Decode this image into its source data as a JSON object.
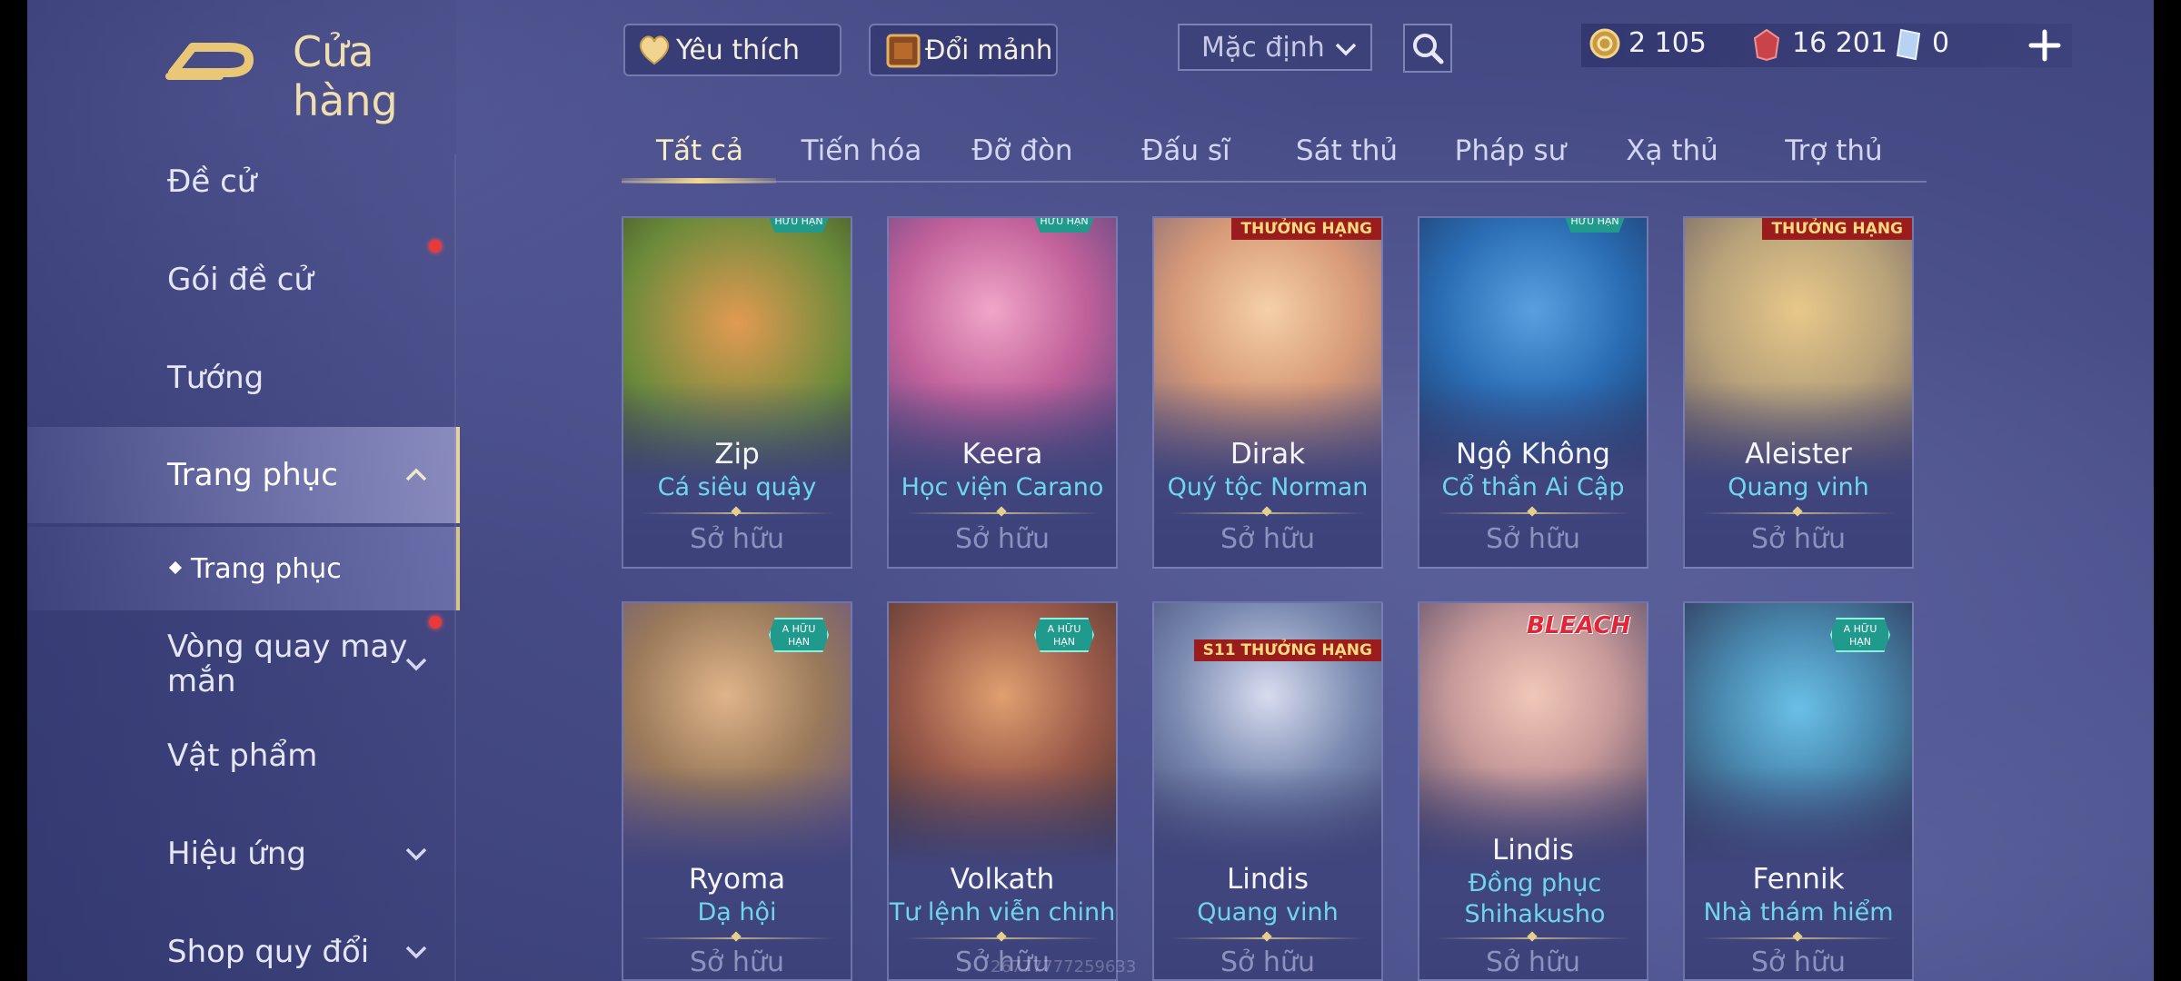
{
  "header": {
    "title": "Cửa hàng",
    "favorites_label": "Yêu thích",
    "exchange_label": "Đổi mảnh",
    "sort_value": "Mặc định"
  },
  "currency": {
    "gold": "2 105",
    "vouchers": "16 201",
    "tickets": "0"
  },
  "sidebar": {
    "items": [
      {
        "label": "Đề cử"
      },
      {
        "label": "Gói đề cử"
      },
      {
        "label": "Tướng"
      },
      {
        "label": "Trang phục"
      },
      {
        "label": "Trang phục"
      },
      {
        "label": "Vòng quay may mắn"
      },
      {
        "label": "Vật phẩm"
      },
      {
        "label": "Hiệu ứng"
      },
      {
        "label": "Shop quy đổi"
      }
    ]
  },
  "tabs": [
    "Tất cả",
    "Tiến hóa",
    "Đỡ đòn",
    "Đấu sĩ",
    "Sát thủ",
    "Pháp sư",
    "Xạ thủ",
    "Trợ thủ"
  ],
  "cards": [
    {
      "hero": "Zip",
      "skin": "Cá siêu quậy",
      "status": "Sở hữu",
      "badge": "HỮU HẠN",
      "art": [
        "#6a8a3a",
        "#e0a040"
      ]
    },
    {
      "hero": "Keera",
      "skin": "Học viện Carano",
      "status": "Sở hữu",
      "badge": "HỮU HẠN",
      "art": [
        "#d77ab0",
        "#3d3f78"
      ]
    },
    {
      "hero": "Dirak",
      "skin": "Quý tộc Norman",
      "status": "Sở hữu",
      "badge": "THƯỞNG HẠNG",
      "art": [
        "#e6b48a",
        "#c79070"
      ]
    },
    {
      "hero": "Ngộ Không",
      "skin": "Cổ thần Ai Cập",
      "status": "Sở hữu",
      "badge": "HỮU HẠN",
      "art": [
        "#2a6db4",
        "#1c2c55"
      ]
    },
    {
      "hero": "Aleister",
      "skin": "Quang vinh",
      "status": "Sở hữu",
      "badge": "THƯỞNG HẠNG",
      "art": [
        "#b8a27a",
        "#6a5a48"
      ]
    },
    {
      "hero": "Ryoma",
      "skin": "Dạ hội",
      "status": "Sở hữu",
      "badge": "A HỮU HẠN",
      "art": [
        "#9a7a5a",
        "#5a4a8a"
      ]
    },
    {
      "hero": "Volkath",
      "skin": "Tư lệnh viễn chinh",
      "status": "Sở hữu",
      "badge": "A HỮU HẠN",
      "art": [
        "#9a5a4a",
        "#3a2a2a"
      ]
    },
    {
      "hero": "Lindis",
      "skin": "Quang vinh",
      "status": "Sở hữu",
      "badge": "S11 THƯỞNG HẠNG",
      "art": [
        "#7a8ab0",
        "#3a3f6a"
      ]
    },
    {
      "hero": "Lindis",
      "skin": "Đồng phục Shihakusho",
      "status": "Sở hữu",
      "badge": "BLEACH",
      "art": [
        "#c79a9a",
        "#3a3458"
      ]
    },
    {
      "hero": "Fennik",
      "skin": "Nhà thám hiểm",
      "status": "Sở hữu",
      "badge": "A HỮU HẠN",
      "art": [
        "#4a8ab0",
        "#2a2a4a"
      ]
    }
  ],
  "watermark": "26777777259633"
}
